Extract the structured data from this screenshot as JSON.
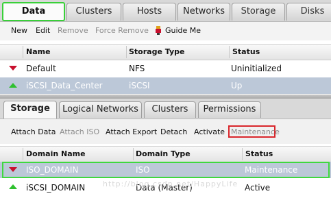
{
  "main_tabs": [
    "Data Centers",
    "Clusters",
    "Hosts",
    "Networks",
    "Storage",
    "Disks"
  ],
  "main_toolbar": {
    "new": "New",
    "edit": "Edit",
    "remove": "Remove",
    "force_remove": "Force Remove",
    "guide_me": "Guide Me"
  },
  "dc_grid": {
    "columns": [
      "Name",
      "Storage Type",
      "Status"
    ],
    "rows": [
      {
        "status_icon": "status-down-icon",
        "name": "Default",
        "storage_type": "NFS",
        "status": "Uninitialized"
      },
      {
        "status_icon": "status-up-icon",
        "name": "iSCSI_Data_Center",
        "storage_type": "iSCSI",
        "status": "Up"
      }
    ]
  },
  "sub_tabs": [
    "Storage",
    "Logical Networks",
    "Clusters",
    "Permissions"
  ],
  "sub_toolbar": {
    "attach_data": "Attach Data",
    "attach_iso": "Attach ISO",
    "attach_export": "Attach Export",
    "detach": "Detach",
    "activate": "Activate",
    "maintenance": "Maintenance"
  },
  "storage_grid": {
    "columns": [
      "Domain Name",
      "Domain Type",
      "Status"
    ],
    "rows": [
      {
        "status_icon": "status-down-icon",
        "name": "ISO_DOMAIN",
        "type": "ISO",
        "status": "Maintenance"
      },
      {
        "status_icon": "status-up-icon",
        "name": "iSCSI_DOMAIN",
        "type": "Data (Master)",
        "status": "Active"
      }
    ]
  },
  "watermark": "http://blog.csdn.net/HappyLife",
  "colors": {
    "highlight": "#3fd83f",
    "maintenance_box": "#d9262b",
    "selected_row": "#bcc8d8"
  }
}
